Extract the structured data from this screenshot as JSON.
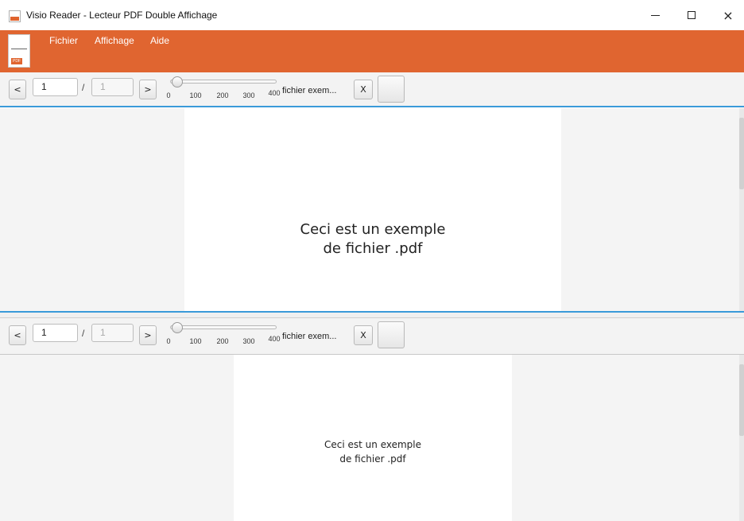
{
  "window": {
    "title": "Visio Reader - Lecteur PDF Double Affichage",
    "minimize": "minimize",
    "maximize": "maximize",
    "close": "×"
  },
  "menu": {
    "items": [
      "Fichier",
      "Affichage",
      "Aide"
    ]
  },
  "logo": {
    "tag": "PDF"
  },
  "toolbar_top": {
    "prev": "<",
    "next": ">",
    "page_value": "1",
    "slash": "/",
    "total_pages": "1",
    "zoom_ticks": [
      "0",
      "100",
      "200",
      "300",
      "400"
    ],
    "zoom_value": 0,
    "file_name": "fichier exem...",
    "close_file": "X"
  },
  "toolbar_bottom": {
    "prev": "<",
    "next": ">",
    "page_value": "1",
    "slash": "/",
    "total_pages": "1",
    "zoom_ticks": [
      "0",
      "100",
      "200",
      "300",
      "400"
    ],
    "zoom_value": 0,
    "file_name": "fichier exem...",
    "close_file": "X"
  },
  "viewer_top": {
    "line1": "Ceci est un exemple",
    "line2": "de fichier .pdf"
  },
  "viewer_bottom": {
    "line1": "Ceci est un exemple",
    "line2": "de fichier .pdf"
  },
  "colors": {
    "accent": "#e06530",
    "focus": "#3a9ad9"
  }
}
